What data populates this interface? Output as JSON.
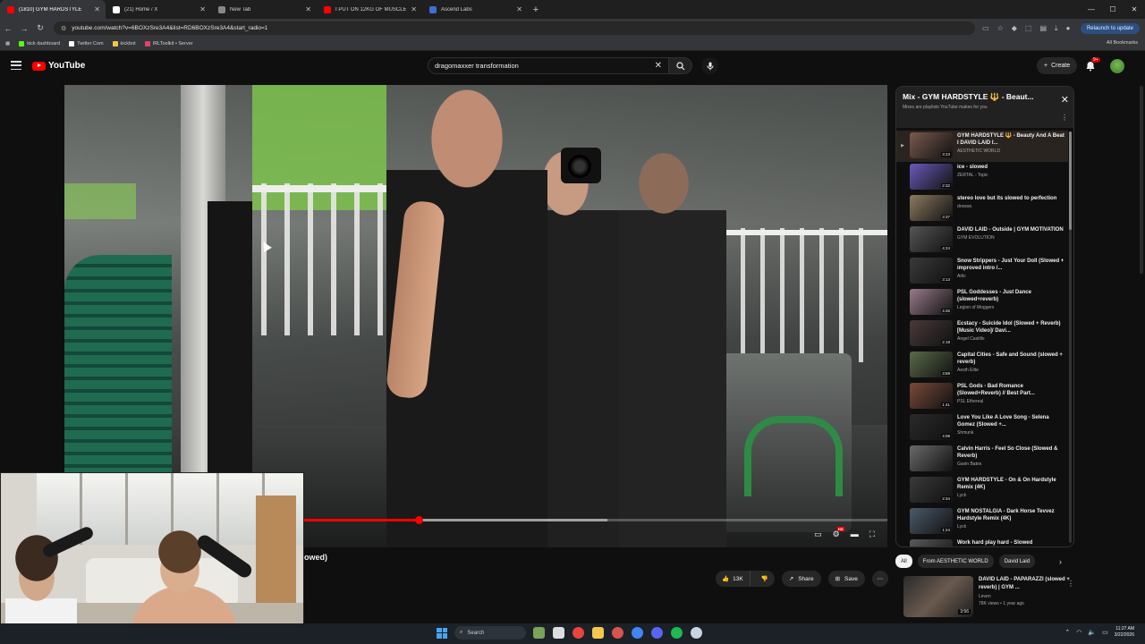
{
  "browser": {
    "tabs": [
      {
        "title": "(1810) GYM HARDSTYLE",
        "color": "#ff0000",
        "active": true
      },
      {
        "title": "(21) Home / X",
        "color": "#ffffff",
        "active": false
      },
      {
        "title": "New Tab",
        "color": "#888888",
        "active": false
      },
      {
        "title": "I PUT ON 12KG OF MUSCLE IN",
        "color": "#ff0000",
        "active": false
      },
      {
        "title": "Ascend Labs",
        "color": "#3a6fd8",
        "active": false
      }
    ],
    "url": "youtube.com/watch?v=6BOXzSre3A4&list=RD6BOXzSre3A4&start_radio=1",
    "relaunch_label": "Relaunch to update",
    "bookmarks": [
      {
        "label": "kick dashboard",
        "color": "#53fc18"
      },
      {
        "label": "Twitter Com",
        "color": "#ffffff"
      },
      {
        "label": "kickbot",
        "color": "#f5c542"
      },
      {
        "label": "IRLToolkit • Server",
        "color": "#e0446a"
      }
    ],
    "all_bookmarks_label": "All Bookmarks"
  },
  "youtube": {
    "logo_text": "YouTube",
    "search_value": "dragomaxxer transformation",
    "create_label": "Create",
    "notification_count": "9+"
  },
  "player": {
    "progress_fraction": 0.43,
    "buffer_fraction": 0.66,
    "title_fragment": "owed)"
  },
  "actions": {
    "likes": "13K",
    "share_label": "Share",
    "save_label": "Save"
  },
  "playlist": {
    "title": "Mix - GYM HARDSTYLE 🔱 - Beaut...",
    "subtitle": "Mixes are playlists YouTube makes for you",
    "items": [
      {
        "title": "GYM HARDSTYLE 🔱 - Beauty And A Beat I DAVID LAID I...",
        "channel": "AESTHETIC WORLD",
        "duration": "3:23",
        "color": "#7a5a4e"
      },
      {
        "title": "ice - slowed",
        "channel": "ZERTAL - Topic",
        "duration": "2:32",
        "color": "#6a5ab8"
      },
      {
        "title": "stereo love but its slowed to perfection",
        "channel": "drowse.",
        "duration": "3:37",
        "color": "#8c7a60"
      },
      {
        "title": "DAVID LAID - Outside | GYM MOTIVATION",
        "channel": "GYM EVOLUTION",
        "duration": "4:24",
        "color": "#555555"
      },
      {
        "title": "Snow Strippers - Just Your Doll (Slowed + improved intro /...",
        "channel": "Arlic",
        "duration": "3:13",
        "color": "#3a3a3a"
      },
      {
        "title": "PSL Goddesses - Just Dance (slowed+reverb)",
        "channel": "Legion of Moggers",
        "duration": "4:26",
        "color": "#9a7a8a"
      },
      {
        "title": "Ecstacy - Suicide Idol (Slowed + Reverb) [Music Video]/ Davi...",
        "channel": "Angel Castillo",
        "duration": "2:18",
        "color": "#4a3a3a"
      },
      {
        "title": "Capital Cities - Safe and Sound (slowed + reverb)",
        "channel": "Aesth Elite",
        "duration": "3:59",
        "color": "#5a6a4a"
      },
      {
        "title": "PSL Gods - Bad Romance (Slowed+Reverb) // Best Part...",
        "channel": "PSL Ethereal",
        "duration": "1:41",
        "color": "#7a4a3a"
      },
      {
        "title": "Love You Like A Love Song - Selena Gomez (Slowed +...",
        "channel": "Shmunk",
        "duration": "4:08",
        "color": "#2a2a2a"
      },
      {
        "title": "Calvin Harris - Feel So Close (Slowed & Reverb)",
        "channel": "Gavin Bates",
        "duration": "",
        "color": "#6a6a6a"
      },
      {
        "title": "GYM HARDSTYLE - On & On Hardstyle Remix (4K)",
        "channel": "Lyck",
        "duration": "2:34",
        "color": "#3a3a3a"
      },
      {
        "title": "GYM NOSTALGIA - Dark Horse Tevvez Hardstyle Remix (4K)",
        "channel": "Lyck",
        "duration": "1:24",
        "color": "#4a5a6a"
      },
      {
        "title": "Work hard play hard - Slowed",
        "channel": "",
        "duration": "",
        "color": "#5a5a5a"
      }
    ]
  },
  "chips": [
    "All",
    "From AESTHETIC WORLD",
    "David Laid"
  ],
  "recommendation": {
    "title": "DAVID LAID - PAPARAZZI (slowed + reverb) | GYM ...",
    "channel": "Leven",
    "stats": "78K views • 1 year ago",
    "duration": "3:56"
  },
  "taskbar": {
    "search_placeholder": "Search",
    "time": "11:27 AM",
    "date": "3/22/2026",
    "icons": [
      {
        "name": "landscape-icon",
        "color": "#7aa35a"
      },
      {
        "name": "task-view-icon",
        "color": "#dddddd"
      },
      {
        "name": "chrome-icon",
        "color": "#e8453c"
      },
      {
        "name": "file-explorer-icon",
        "color": "#f2c94c"
      },
      {
        "name": "chrome-alt-icon",
        "color": "#d9534f"
      },
      {
        "name": "chrome-profile-icon",
        "color": "#4285f4"
      },
      {
        "name": "discord-icon",
        "color": "#5865f2"
      },
      {
        "name": "spotify-icon",
        "color": "#1db954"
      },
      {
        "name": "steam-icon",
        "color": "#c7d5e0"
      }
    ]
  }
}
